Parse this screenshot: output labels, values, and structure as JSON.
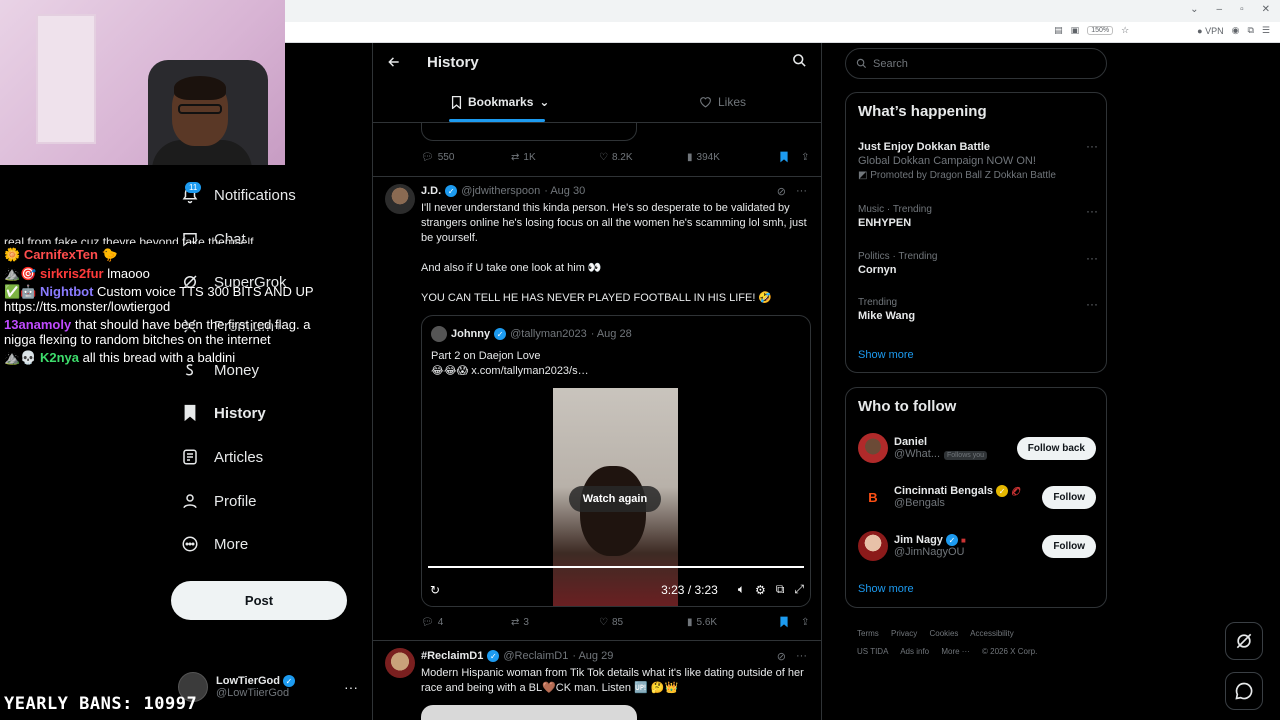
{
  "browser": {
    "zoom": "150%",
    "vpn_label": "VPN"
  },
  "nav": {
    "badge": "11",
    "items": [
      {
        "label": "Notifications",
        "icon": "bell-icon"
      },
      {
        "label": "Chat",
        "icon": "chat-icon"
      },
      {
        "label": "SuperGrok",
        "icon": "grok-icon"
      },
      {
        "label": "Premium+",
        "icon": "x-icon"
      },
      {
        "label": "Money",
        "icon": "money-icon"
      },
      {
        "label": "History",
        "icon": "bookmark-icon"
      },
      {
        "label": "Articles",
        "icon": "articles-icon"
      },
      {
        "label": "Profile",
        "icon": "profile-icon"
      },
      {
        "label": "More",
        "icon": "more-icon"
      }
    ],
    "post_label": "Post",
    "account": {
      "name": "LowTierGod",
      "handle": "@LowTiierGod"
    }
  },
  "chat": {
    "cut_line": "real from fake cuz theyre beyond fake themself",
    "messages": [
      {
        "user": "CarnifexTen",
        "color": "#ff4d4d",
        "text": ""
      },
      {
        "user": "sirkris2fur",
        "color": "#ff3b3b",
        "text": "lmaooo"
      },
      {
        "user": "Nightbot",
        "color": "#8a7bff",
        "text": "Custom voice TTS 300 BITS AND UP https://tts.monster/lowtiergod"
      },
      {
        "user": "13anamoly",
        "color": "#c04bff",
        "text": "that should have been the first red flag. a nigga flexing to random bitches on the internet"
      },
      {
        "user": "K2nya",
        "color": "#3ddc6b",
        "text": "all this bread with a baldini"
      }
    ],
    "bans": "YEARLY BANS: 10997"
  },
  "header": {
    "title": "History",
    "tab_bookmarks": "Bookmarks",
    "tab_likes": "Likes"
  },
  "tweet0": {
    "replies": "550",
    "reposts": "1K",
    "likes": "8.2K",
    "views": "394K"
  },
  "tweet1": {
    "name": "J.D.",
    "handle": "@jdwitherspoon",
    "date": "· Aug 30",
    "p1": "I'll never understand this kinda person. He's so desperate to be validated by strangers online he's losing focus on all the women he's scamming lol smh, just be yourself.",
    "p2": "And also if U take one look at him 👀",
    "p3": "YOU CAN TELL HE HAS NEVER PLAYED FOOTBALL IN HIS LIFE! 🤣",
    "quote": {
      "name": "Johnny",
      "handle": "@tallyman2023",
      "date": "· Aug 28",
      "line1": "Part 2 on Daejon Love",
      "line2": "😂😂😱 x.com/tallyman2023/s…",
      "watch_again": "Watch again",
      "time": "3:23 / 3:23"
    },
    "replies": "4",
    "reposts": "3",
    "likes": "85",
    "views": "5.6K"
  },
  "tweet2": {
    "name": "#ReclaimD1",
    "handle": "@ReclaimD1",
    "date": "· Aug 29",
    "text": "Modern Hispanic woman from Tik Tok details what it's like dating outside of her race and being with a BL🤎CK man. Listen 🆙 🤔👑"
  },
  "right": {
    "search_placeholder": "Search",
    "happening_title": "What’s happening",
    "trends": [
      {
        "context": "",
        "title": "Just Enjoy Dokkan Battle",
        "desc": "Global Dokkan Campaign NOW ON!",
        "promo": "Promoted by Dragon Ball Z Dokkan Battle"
      },
      {
        "context": "Music · Trending",
        "title": "ENHYPEN",
        "desc": "",
        "promo": ""
      },
      {
        "context": "Politics · Trending",
        "title": "Cornyn",
        "desc": "",
        "promo": ""
      },
      {
        "context": "Trending",
        "title": "Mike Wang",
        "desc": "",
        "promo": ""
      }
    ],
    "show_more": "Show more",
    "who_title": "Who to follow",
    "who": [
      {
        "name": "Daniel",
        "handle": "@What...",
        "follows_you": "Follows you",
        "button": "Follow back"
      },
      {
        "name": "Cincinnati Bengals",
        "handle": "@Bengals",
        "follows_you": "",
        "button": "Follow"
      },
      {
        "name": "Jim Nagy",
        "handle": "@JimNagyOU",
        "follows_you": "",
        "button": "Follow"
      }
    ],
    "footer": [
      "Terms",
      "Privacy",
      "Cookies",
      "Accessibility",
      "US TIDA",
      "Ads info",
      "More ···",
      "© 2026 X Corp."
    ]
  }
}
